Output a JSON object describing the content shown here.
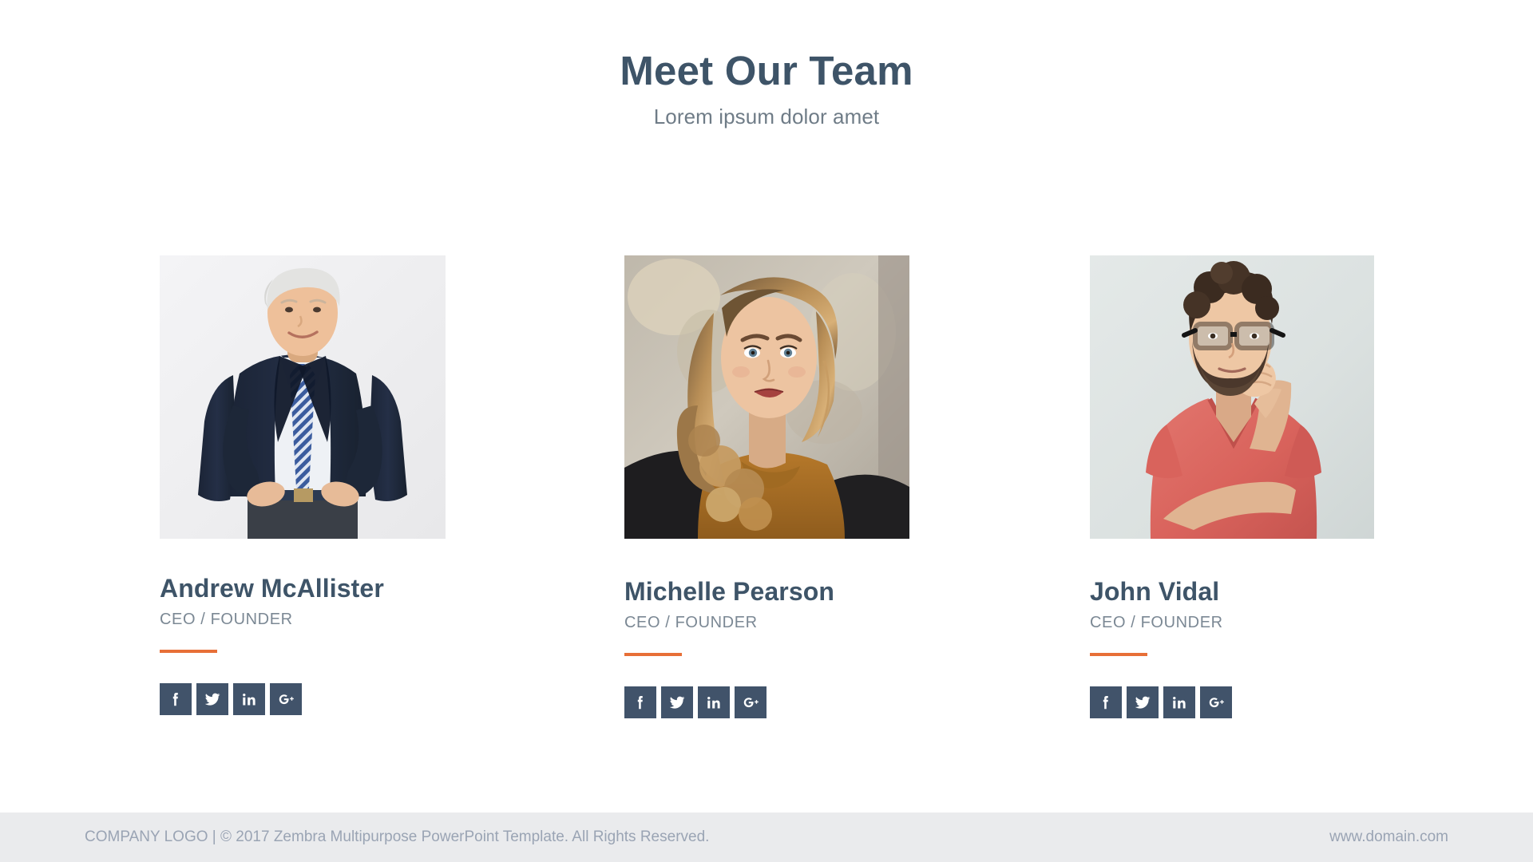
{
  "header": {
    "title": "Meet Our Team",
    "subtitle": "Lorem ipsum dolor amet"
  },
  "colors": {
    "heading": "#3e5468",
    "subtitle": "#6f7c87",
    "accent_orange": "#e76f37",
    "social_tile": "#41536a",
    "footer_bg": "#eaebed",
    "footer_text": "#9aa4b4",
    "page_bg": "#ffffff"
  },
  "team": {
    "members": [
      {
        "name": "Andrew McAllister",
        "role": "CEO / FOUNDER",
        "photo_alt": "Senior businessman in navy suit and striped tie, hands on hips, light gray studio background",
        "socials": [
          {
            "icon": "facebook-icon",
            "label": "Facebook"
          },
          {
            "icon": "twitter-icon",
            "label": "Twitter"
          },
          {
            "icon": "linkedin-icon",
            "label": "LinkedIn"
          },
          {
            "icon": "google-plus-icon",
            "label": "Google Plus"
          }
        ]
      },
      {
        "name": "Michelle Pearson",
        "role": "CEO / FOUNDER",
        "photo_alt": "Young woman with long wavy blonde hair wearing a mustard knit sweater and black jacket, blurred street background",
        "socials": [
          {
            "icon": "facebook-icon",
            "label": "Facebook"
          },
          {
            "icon": "twitter-icon",
            "label": "Twitter"
          },
          {
            "icon": "linkedin-icon",
            "label": "LinkedIn"
          },
          {
            "icon": "google-plus-icon",
            "label": "Google Plus"
          }
        ]
      },
      {
        "name": "John Vidal",
        "role": "CEO / FOUNDER",
        "photo_alt": "Bearded man with glasses in a red v-neck t-shirt, hand on chin, pale gray studio background",
        "socials": [
          {
            "icon": "facebook-icon",
            "label": "Facebook"
          },
          {
            "icon": "twitter-icon",
            "label": "Twitter"
          },
          {
            "icon": "linkedin-icon",
            "label": "LinkedIn"
          },
          {
            "icon": "google-plus-icon",
            "label": "Google Plus"
          }
        ]
      }
    ]
  },
  "footer": {
    "copyright": "COMPANY LOGO | © 2017 Zembra Multipurpose PowerPoint Template. All Rights Reserved.",
    "website": "www.domain.com"
  }
}
